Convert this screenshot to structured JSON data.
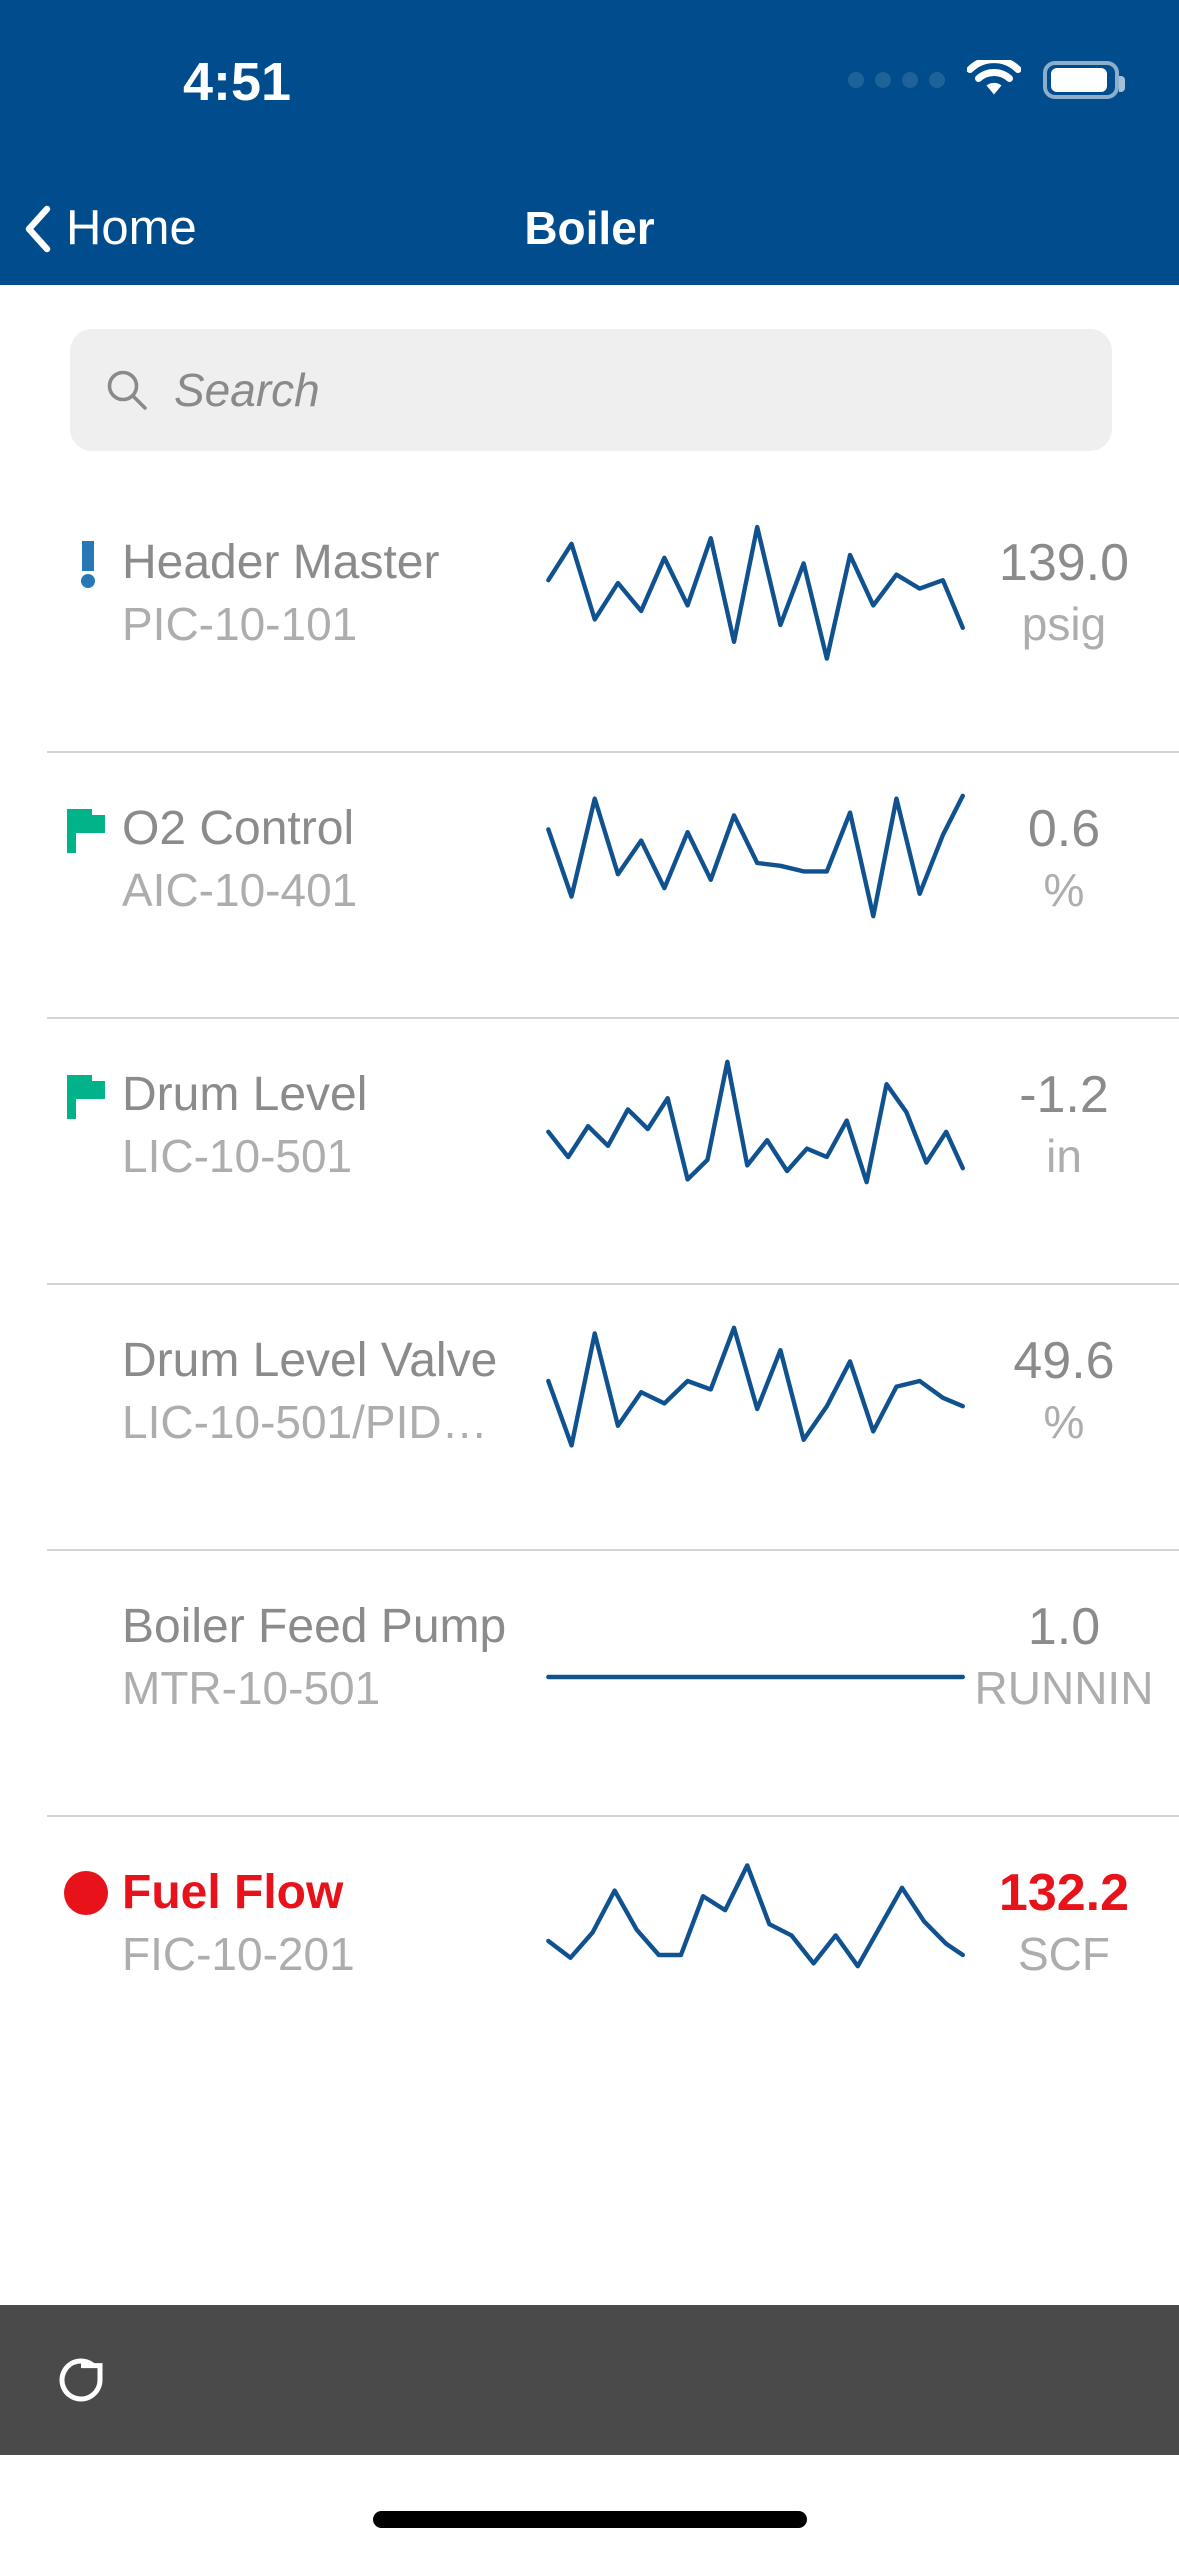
{
  "theme": {
    "brand_color": "#014C8C",
    "sparkline_color": "#10528F",
    "ok_color": "#00B388",
    "alert_color": "#2878B5",
    "alarm_color": "#E8131A",
    "toolbar_color": "#4A4A4A",
    "search_bg": "#EFEFEF"
  },
  "status_bar": {
    "time": "4:51",
    "signal_icon": "cellular-dots-icon",
    "wifi_icon": "wifi-icon",
    "battery_icon": "battery-icon"
  },
  "nav": {
    "back_icon": "chevron-left-icon",
    "back_label": "Home",
    "title": "Boiler"
  },
  "search": {
    "icon": "search-icon",
    "placeholder": "Search",
    "value": ""
  },
  "list": {
    "rows": [
      {
        "status_icon": "alert-exclamation-icon",
        "name": "Header Master",
        "tag": "PIC-10-101",
        "value": "139.0",
        "unit": "psig",
        "alarm": false,
        "spark": "flag-blue"
      },
      {
        "status_icon": "flag-icon",
        "name": "O2 Control",
        "tag": "AIC-10-401",
        "value": "0.6",
        "unit": "%",
        "alarm": false,
        "spark": "normal"
      },
      {
        "status_icon": "flag-icon",
        "name": "Drum Level",
        "tag": "LIC-10-501",
        "value": "-1.2",
        "unit": "in",
        "alarm": false,
        "spark": "normal"
      },
      {
        "status_icon": "",
        "name": "Drum Level Valve",
        "tag": "LIC-10-501/PID…",
        "value": "49.6",
        "unit": "%",
        "alarm": false,
        "spark": "normal"
      },
      {
        "status_icon": "",
        "name": "Boiler Feed Pump",
        "tag": "MTR-10-501",
        "value": "1.0",
        "unit": "RUNNIN",
        "alarm": false,
        "spark": "flat"
      },
      {
        "status_icon": "circle-alarm-icon",
        "name": "Fuel Flow",
        "tag": "FIC-10-201",
        "value": "132.2",
        "unit": "SCF",
        "alarm": true,
        "spark": "normal"
      }
    ]
  },
  "chart_data": [
    {
      "type": "line",
      "title": "Header Master PIC-10-101 sparkline",
      "ylabel": "psig",
      "points": [
        62,
        34,
        88,
        60,
        40,
        78,
        44,
        92,
        18,
        100,
        30,
        74,
        6,
        80,
        44,
        66,
        56,
        62,
        28
      ],
      "ylim": [
        0,
        100
      ],
      "grid": false
    },
    {
      "type": "line",
      "title": "O2 Control AIC-10-401 sparkline",
      "ylabel": "%",
      "points": [
        72,
        28,
        96,
        48,
        66,
        34,
        74,
        40,
        84,
        52,
        50,
        46,
        46,
        86,
        14,
        96,
        30,
        70,
        98
      ],
      "ylim": [
        0,
        100
      ],
      "grid": false
    },
    {
      "type": "line",
      "title": "Drum Level LIC-10-501 sparkline",
      "ylabel": "in",
      "points": [
        58,
        40,
        60,
        46,
        70,
        56,
        76,
        22,
        34,
        100,
        30,
        48,
        26,
        42,
        36,
        60,
        18,
        82,
        66,
        30,
        50,
        26
      ],
      "ylim": [
        0,
        100
      ],
      "grid": false
    },
    {
      "type": "line",
      "title": "Drum Level Valve LIC-10-501/PID sparkline",
      "ylabel": "%",
      "points": [
        60,
        16,
        96,
        30,
        54,
        46,
        62,
        56,
        100,
        42,
        84,
        20,
        44,
        76,
        26,
        58,
        62,
        50,
        44
      ],
      "ylim": [
        0,
        100
      ],
      "grid": false
    },
    {
      "type": "line",
      "title": "Boiler Feed Pump MTR-10-501 sparkline",
      "ylabel": "RUNNING",
      "points": [
        50,
        50,
        50,
        50,
        50,
        50,
        50,
        50,
        50,
        50
      ],
      "ylim": [
        0,
        100
      ],
      "grid": false
    },
    {
      "type": "line",
      "title": "Fuel Flow FIC-10-201 sparkline",
      "ylabel": "SCF",
      "points": [
        40,
        28,
        46,
        76,
        48,
        30,
        30,
        72,
        62,
        94,
        52,
        44,
        24,
        44,
        22,
        50,
        78,
        54,
        38,
        30
      ],
      "ylim": [
        0,
        100
      ],
      "grid": false
    }
  ],
  "toolbar": {
    "refresh_icon": "refresh-icon"
  },
  "home_indicator": "home-indicator-bar"
}
